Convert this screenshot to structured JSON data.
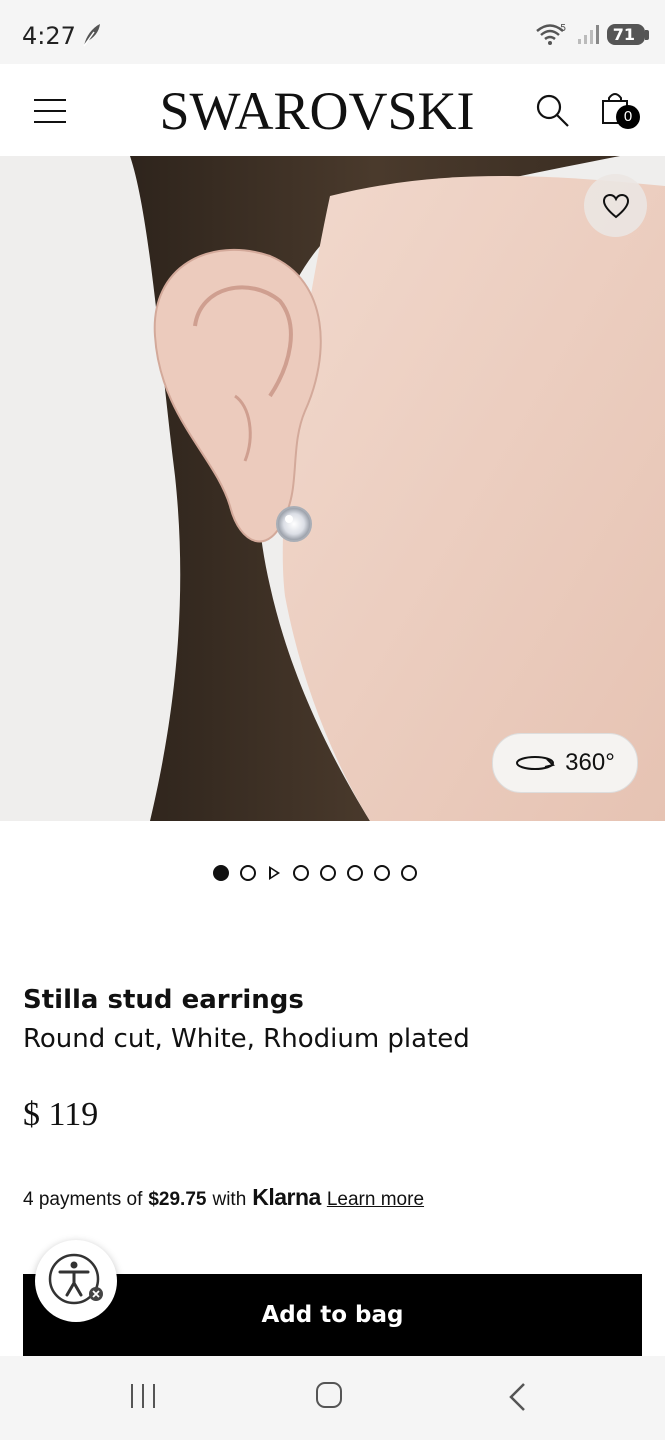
{
  "status_bar": {
    "time": "4:27",
    "wifi_label": "5",
    "battery": "71"
  },
  "header": {
    "brand": "SWAROVSKI",
    "cart_count": "0"
  },
  "gallery": {
    "view_360_label": "360°",
    "pages_total": 8,
    "active_page": 1
  },
  "product": {
    "name": "Stilla stud earrings",
    "variant": "Round cut, White, Rhodium plated",
    "price": "$ 119"
  },
  "payment": {
    "prefix": "4 payments of",
    "amount": "$29.75",
    "with": "with",
    "provider": "Klarna",
    "learn_more": "Learn more"
  },
  "actions": {
    "add_to_bag": "Add to bag"
  },
  "colors": {
    "accent": "#000000",
    "background": "#ffffff",
    "hero_bg": "#efeeed"
  },
  "icons": [
    "menu-icon",
    "search-icon",
    "bag-icon",
    "heart-icon",
    "rotate-360-icon",
    "play-icon",
    "accessibility-icon",
    "close-icon"
  ]
}
